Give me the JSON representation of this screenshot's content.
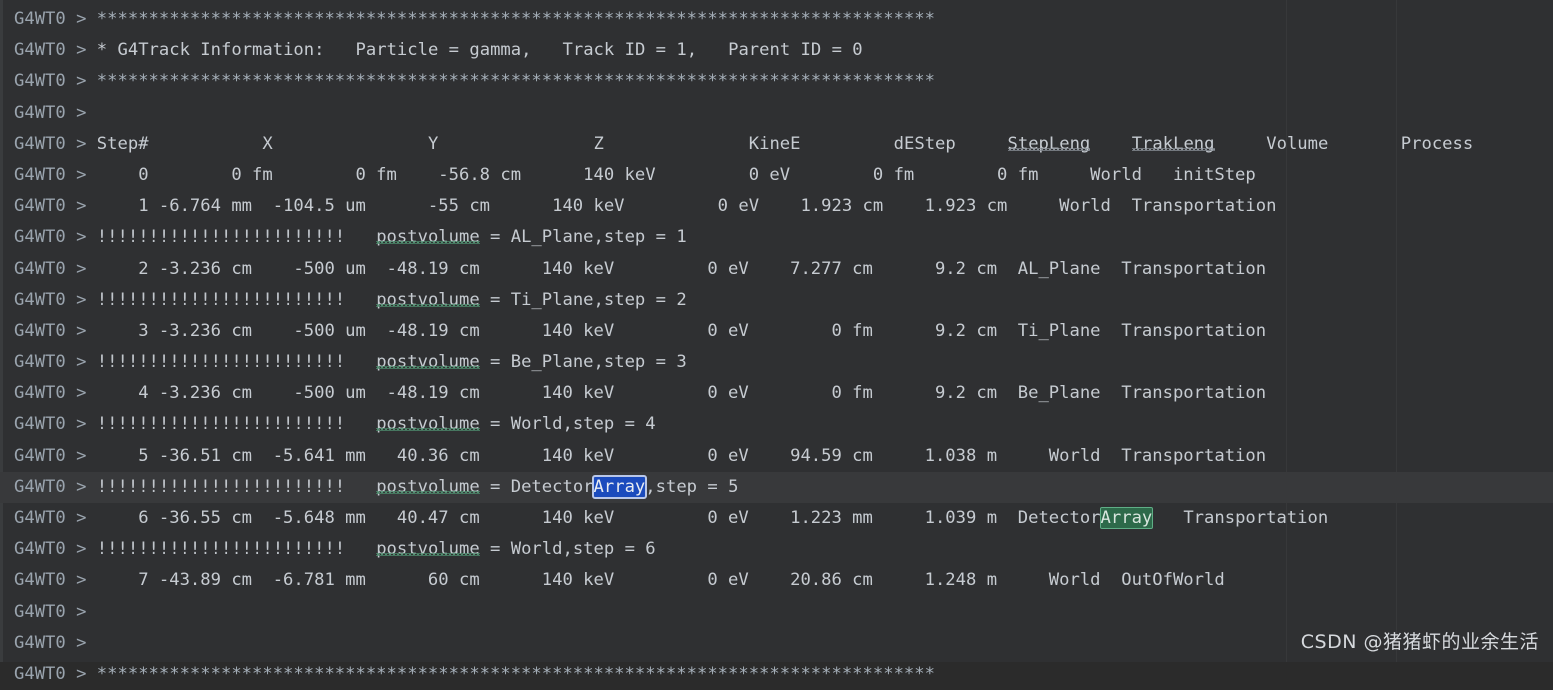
{
  "console": {
    "prefix": "G4WT0 > ",
    "colors": {
      "background": "#2f3032",
      "current_line": "#38393b",
      "text": "#c6cbd1",
      "prefix": "#9aa4ae",
      "selection_primary_bg": "#1b4bbd",
      "selection_primary_border": "#b9c7e8",
      "selection_match_bg": "#2d6a4a",
      "selection_match_border": "#5fae86",
      "squiggle": "#4e8d6e"
    },
    "selected_word": "Array",
    "rule_line": "*********************************************************************************",
    "bang_line": "!!!!!!!!!!!!!!!!!!!!!!!!",
    "banner": {
      "star": "*",
      "label": "G4Track Information:",
      "particle_label": "Particle",
      "particle_value": "gamma,",
      "track_id_label": "Track ID",
      "track_id_value": "1,",
      "parent_id_label": "Parent ID",
      "parent_id_value": "0"
    },
    "table": {
      "headers": [
        "Step#",
        "X",
        "Y",
        "Z",
        "KineE",
        "dEStep",
        "StepLeng",
        "TrakLeng",
        "Volume",
        "Process"
      ],
      "header_line": "Step#           X               Y               Z              KineE         dEStep     StepLeng    TrakLeng     Volume       Process",
      "rows": [
        {
          "step": "0",
          "x": "0 fm",
          "y": "0 fm",
          "z": "-56.8 cm",
          "kine_e": "140 keV",
          "de_step": "0 eV",
          "step_leng": "0 fm",
          "trak_leng": "0 fm",
          "volume": "World",
          "process": "initStep",
          "line": "    0        0 fm        0 fm    -56.8 cm      140 keV         0 eV        0 fm        0 fm     World   initStep"
        },
        {
          "step": "1",
          "x": "-6.764 mm",
          "y": "-104.5 um",
          "z": "-55 cm",
          "kine_e": "140 keV",
          "de_step": "0 eV",
          "step_leng": "1.923 cm",
          "trak_leng": "1.923 cm",
          "volume": "World",
          "process": "Transportation",
          "line": "    1 -6.764 mm  -104.5 um      -55 cm      140 keV         0 eV    1.923 cm    1.923 cm     World  Transportation"
        },
        {
          "step": "2",
          "x": "-3.236 cm",
          "y": "-500 um",
          "z": "-48.19 cm",
          "kine_e": "140 keV",
          "de_step": "0 eV",
          "step_leng": "7.277 cm",
          "trak_leng": "9.2 cm",
          "volume": "AL_Plane",
          "process": "Transportation",
          "line": "    2 -3.236 cm    -500 um  -48.19 cm      140 keV         0 eV    7.277 cm      9.2 cm  AL_Plane  Transportation"
        },
        {
          "step": "3",
          "x": "-3.236 cm",
          "y": "-500 um",
          "z": "-48.19 cm",
          "kine_e": "140 keV",
          "de_step": "0 eV",
          "step_leng": "0 fm",
          "trak_leng": "9.2 cm",
          "volume": "Ti_Plane",
          "process": "Transportation",
          "line": "    3 -3.236 cm    -500 um  -48.19 cm      140 keV         0 eV        0 fm      9.2 cm  Ti_Plane  Transportation"
        },
        {
          "step": "4",
          "x": "-3.236 cm",
          "y": "-500 um",
          "z": "-48.19 cm",
          "kine_e": "140 keV",
          "de_step": "0 eV",
          "step_leng": "0 fm",
          "trak_leng": "9.2 cm",
          "volume": "Be_Plane",
          "process": "Transportation",
          "line": "    4 -3.236 cm    -500 um  -48.19 cm      140 keV         0 eV        0 fm      9.2 cm  Be_Plane  Transportation"
        },
        {
          "step": "5",
          "x": "-36.51 cm",
          "y": "-5.641 mm",
          "z": "40.36 cm",
          "kine_e": "140 keV",
          "de_step": "0 eV",
          "step_leng": "94.59 cm",
          "trak_leng": "1.038 m",
          "volume": "World",
          "process": "Transportation",
          "line": "    5 -36.51 cm  -5.641 mm   40.36 cm      140 keV         0 eV    94.59 cm     1.038 m     World  Transportation"
        },
        {
          "step": "6",
          "x": "-36.55 cm",
          "y": "-5.648 mm",
          "z": "40.47 cm",
          "kine_e": "140 keV",
          "de_step": "0 eV",
          "step_leng": "1.223 mm",
          "trak_leng": "1.039 m",
          "volume": "DetectorArray",
          "process": "Transportation",
          "line_pre": "    6 -36.55 cm  -5.648 mm   40.47 cm      140 keV         0 eV    1.223 mm     1.039 m  Detector",
          "line_post": "   Transportation"
        },
        {
          "step": "7",
          "x": "-43.89 cm",
          "y": "-6.781 mm",
          "z": "60 cm",
          "kine_e": "140 keV",
          "de_step": "0 eV",
          "step_leng": "20.86 cm",
          "trak_leng": "1.248 m",
          "volume": "World",
          "process": "OutOfWorld",
          "line": "    7 -43.89 cm  -6.781 mm      60 cm      140 keV         0 eV    20.86 cm     1.248 m     World  OutOfWorld"
        }
      ],
      "postvolume_lines": [
        {
          "word": "postvolume",
          "eq": " = ",
          "volume": "AL_Plane",
          "step": ",step = 1"
        },
        {
          "word": "postvolume",
          "eq": " = ",
          "volume": "Ti_Plane",
          "step": ",step = 2"
        },
        {
          "word": "postvolume",
          "eq": " = ",
          "volume": "Be_Plane",
          "step": ",step = 3"
        },
        {
          "word": "postvolume",
          "eq": " = ",
          "volume": "World",
          "step": ",step = 4"
        },
        {
          "word": "postvolume",
          "eq": " = ",
          "volume_pre": "Detector",
          "volume_sel": "Array",
          "step": ",step = 5"
        },
        {
          "word": "postvolume",
          "eq": " = ",
          "volume": "World",
          "step": ",step = 6"
        }
      ],
      "empty": ""
    }
  },
  "watermark": {
    "text": "CSDN @猪猪虾的业余生活"
  }
}
